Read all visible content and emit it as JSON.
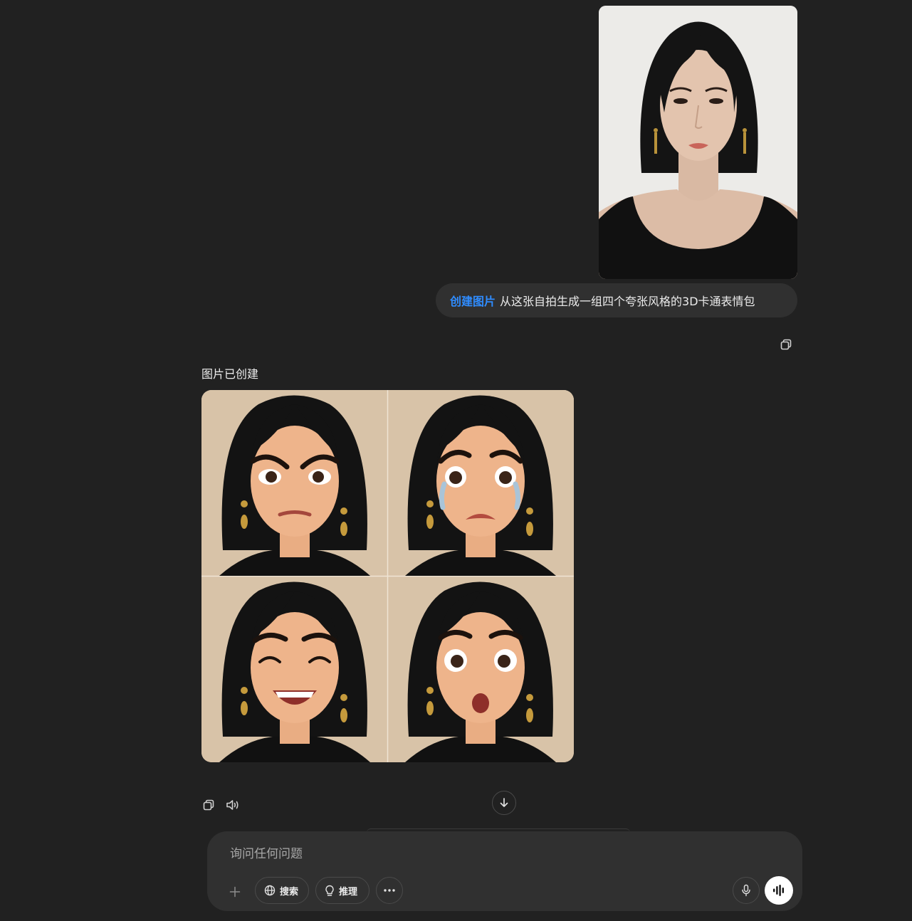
{
  "user_message": {
    "tool_tag": "创建图片",
    "prompt": "从这张自拍生成一组四个夸张风格的3D卡通表情包"
  },
  "assistant": {
    "status": "图片已创建"
  },
  "composer": {
    "placeholder": "询问任何问题",
    "search_label": "搜索",
    "reason_label": "推理"
  },
  "icons": {
    "copy": "copy-icon",
    "speaker": "speaker-icon",
    "scroll": "arrow-down-icon",
    "plus": "plus-icon",
    "globe": "globe-icon",
    "bulb": "lightbulb-icon",
    "more": "ellipsis-icon",
    "mic": "microphone-icon",
    "voice": "voice-waveform-icon"
  },
  "colors": {
    "background": "#212121",
    "bubble": "#303030",
    "tool_tag": "#2f8cff",
    "text": "#ececec"
  }
}
